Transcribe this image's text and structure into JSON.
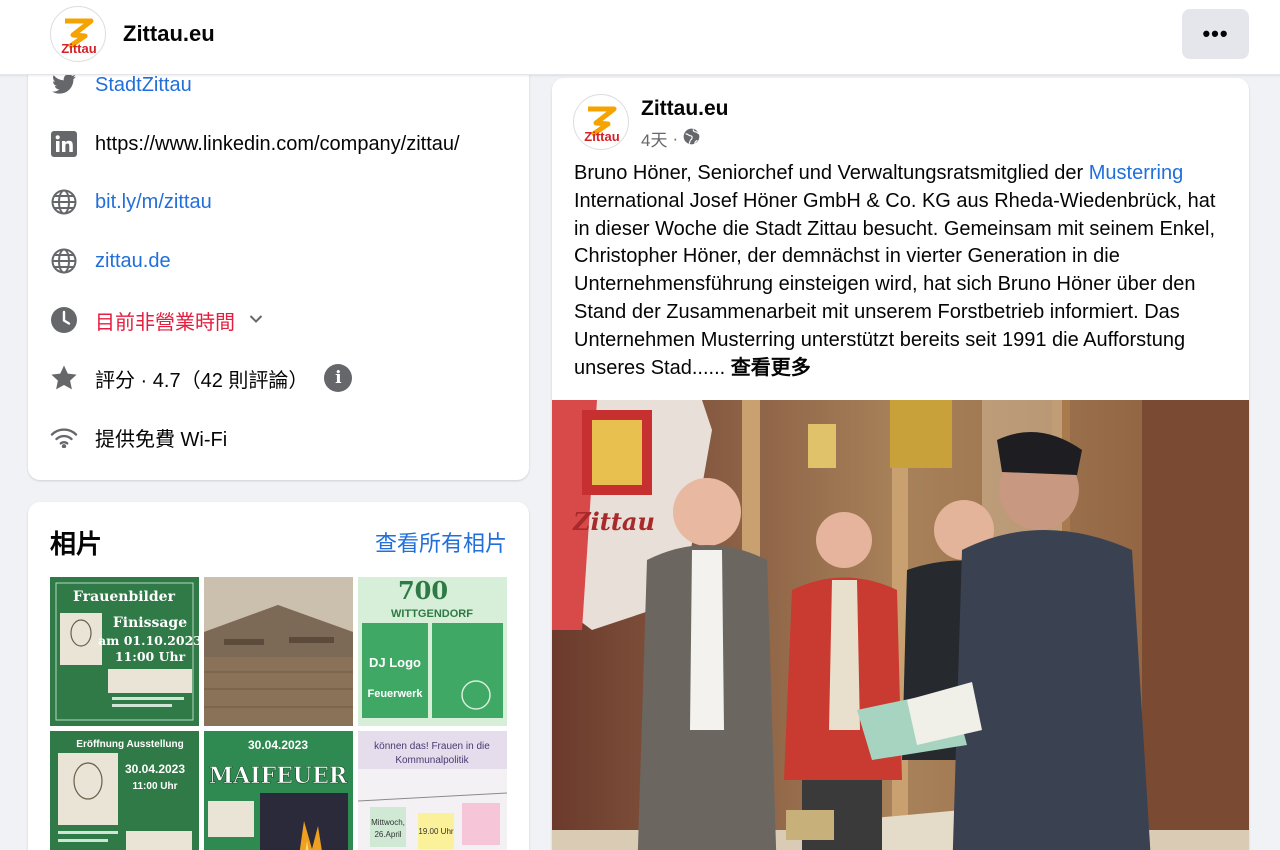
{
  "header": {
    "page_name": "Zittau.eu",
    "logo_text": "Zittau",
    "more_label": "•••"
  },
  "intro": {
    "twitter": "StadtZittau",
    "linkedin": "https://www.linkedin.com/company/zittau/",
    "website1": "bit.ly/m/zittau",
    "website2": "zittau.de",
    "hours": "目前非營業時間",
    "rating": "評分 · 4.7（42 則評論）",
    "wifi": "提供免費 Wi-Fi"
  },
  "photos": {
    "title": "相片",
    "see_all": "查看所有相片",
    "thumbs": [
      {
        "lines": [
          "Frauenbilder",
          "Finissage",
          "am 01.10.2023",
          "11:00 Uhr"
        ],
        "bg": "#2f7a46"
      },
      {
        "lines": [],
        "bg": "#8a7158"
      },
      {
        "lines": [
          "700",
          "WITTGENDORF",
          "DJ Logo",
          "Feuerwerk"
        ],
        "bg": "#3fa865"
      },
      {
        "lines": [
          "Eröffnung Ausstellung",
          "30.04.2023",
          "11:00 Uhr"
        ],
        "bg": "#2f7a46"
      },
      {
        "lines": [
          "30.04.2023",
          "MAIFEUER"
        ],
        "bg": "#2e8a50"
      },
      {
        "lines": [
          "können das! Frauen in die",
          "Kommunalpolitik",
          "Mittwoch,",
          "26.April",
          "19.00 Uhr"
        ],
        "bg": "#f4f1f4"
      }
    ]
  },
  "post": {
    "author": "Zittau.eu",
    "time": "4天",
    "text_before_link": "Bruno Höner, Seniorchef und Verwaltungsratsmitglied der ",
    "link_text": "Musterring",
    "text_after_link": " International Josef Höner GmbH & Co. KG aus Rheda-Wiedenbrück, hat in dieser Woche die Stadt Zittau besucht. Gemeinsam mit seinem Enkel, Christopher Höner, der demnächst in vierter Generation in die Unternehmensführung einsteigen wird, hat sich Bruno Höner über den Stand der Zusammenarbeit mit unserem Forstbetrieb informiert. Das Unternehmen Musterring unterstützt bereits seit 1991 die Aufforstung unseres Stad......",
    "see_more": "查看更多",
    "banner_text": "Zittau"
  },
  "colors": {
    "link": "#216fdb",
    "red": "#e41e3f",
    "icon": "#65676b"
  }
}
